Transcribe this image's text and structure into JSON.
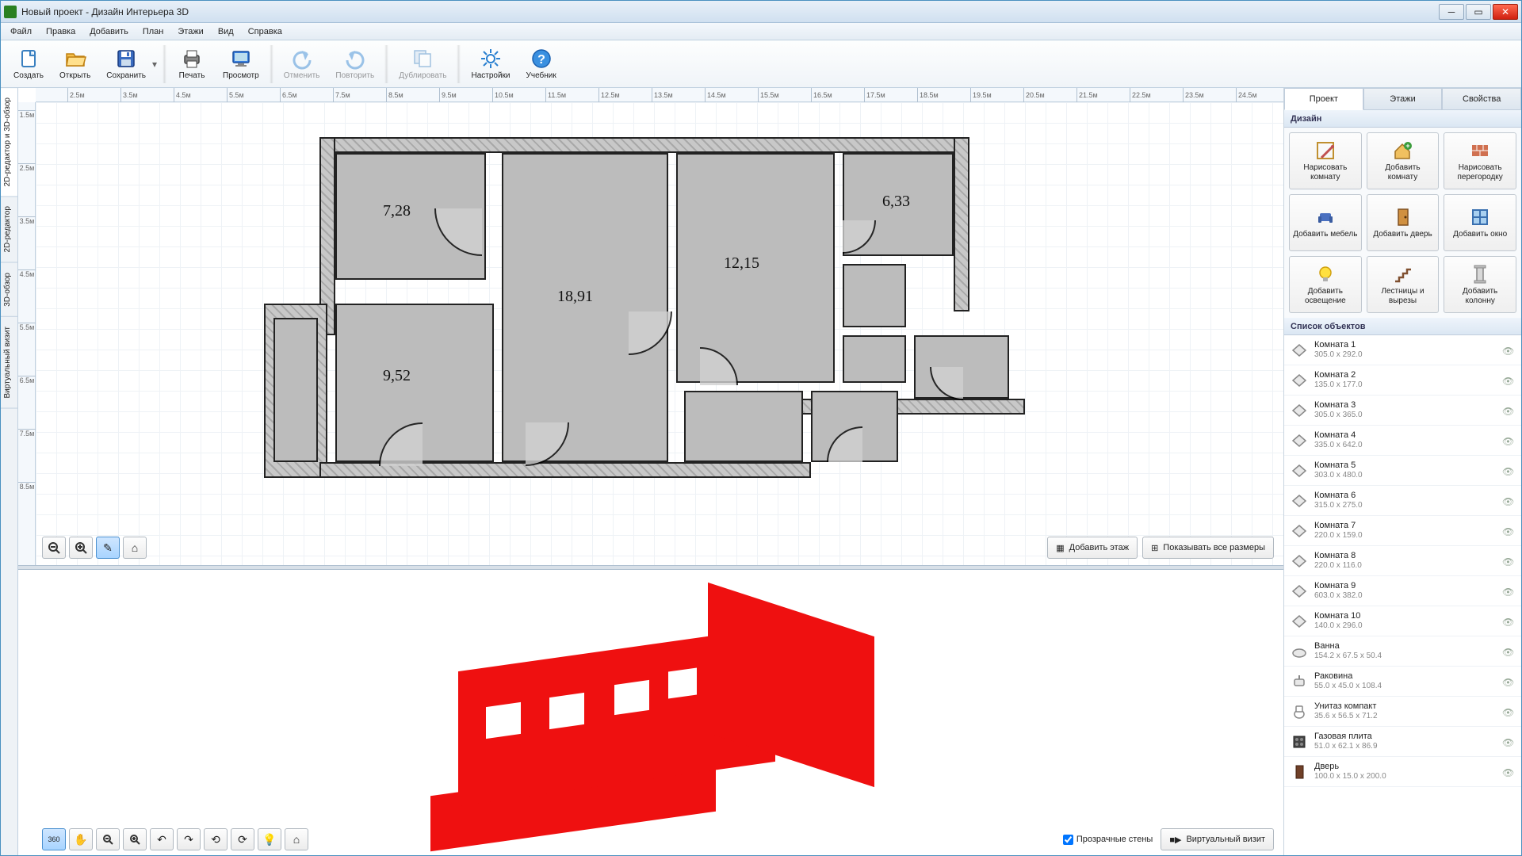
{
  "window_title": "Новый проект - Дизайн Интерьера 3D",
  "menu": [
    "Файл",
    "Правка",
    "Добавить",
    "План",
    "Этажи",
    "Вид",
    "Справка"
  ],
  "toolbar": [
    {
      "id": "new",
      "label": "Создать",
      "disabled": false
    },
    {
      "id": "open",
      "label": "Открыть",
      "disabled": false
    },
    {
      "id": "save",
      "label": "Сохранить",
      "disabled": false,
      "hasDropdown": true
    },
    {
      "sep": true
    },
    {
      "id": "print",
      "label": "Печать",
      "disabled": false
    },
    {
      "id": "preview",
      "label": "Просмотр",
      "disabled": false
    },
    {
      "sep": true
    },
    {
      "id": "undo",
      "label": "Отменить",
      "disabled": true
    },
    {
      "id": "redo",
      "label": "Повторить",
      "disabled": true
    },
    {
      "sep": true
    },
    {
      "id": "duplicate",
      "label": "Дублировать",
      "disabled": true
    },
    {
      "sep": true
    },
    {
      "id": "settings",
      "label": "Настройки",
      "disabled": false
    },
    {
      "id": "tutorial",
      "label": "Учебник",
      "disabled": false
    }
  ],
  "left_tabs": [
    "2D-редактор и 3D-обзор",
    "2D-редактор",
    "3D-обзор",
    "Виртуальный визит"
  ],
  "ruler_h": [
    "2.5м",
    "3.5м",
    "4.5м",
    "5.5м",
    "6.5м",
    "7.5м",
    "8.5м",
    "9.5м",
    "10.5м",
    "11.5м",
    "12.5м",
    "13.5м",
    "14.5м",
    "15.5м",
    "16.5м",
    "17.5м",
    "18.5м",
    "19.5м",
    "20.5м",
    "21.5м",
    "22.5м",
    "23.5м",
    "24.5м"
  ],
  "ruler_v": [
    "1.5м",
    "2.5м",
    "3.5м",
    "4.5м",
    "5.5м",
    "6.5м",
    "7.5м",
    "8.5м"
  ],
  "room_labels": {
    "r1": "7,28",
    "r2": "18,91",
    "r3": "12,15",
    "r4": "6,33",
    "r5": "9,52"
  },
  "canvas_buttons": {
    "add_floor": "Добавить этаж",
    "show_dims": "Показывать все размеры"
  },
  "canvas3d_footer": {
    "transparent_walls": "Прозрачные стены",
    "virtual_visit": "Виртуальный визит"
  },
  "right_tabs": [
    "Проект",
    "Этажи",
    "Свойства"
  ],
  "design_header": "Дизайн",
  "design_tools": [
    {
      "id": "draw-room",
      "label": "Нарисовать\nкомнату"
    },
    {
      "id": "add-room",
      "label": "Добавить\nкомнату"
    },
    {
      "id": "draw-wall",
      "label": "Нарисовать\nперегородку"
    },
    {
      "id": "add-furniture",
      "label": "Добавить\nмебель"
    },
    {
      "id": "add-door",
      "label": "Добавить\nдверь"
    },
    {
      "id": "add-window",
      "label": "Добавить\nокно"
    },
    {
      "id": "add-light",
      "label": "Добавить\nосвещение"
    },
    {
      "id": "stairs",
      "label": "Лестницы и\nвырезы"
    },
    {
      "id": "add-column",
      "label": "Добавить\nколонну"
    }
  ],
  "objects_header": "Список объектов",
  "objects": [
    {
      "name": "Комната 1",
      "dims": "305.0 x 292.0",
      "kind": "room"
    },
    {
      "name": "Комната 2",
      "dims": "135.0 x 177.0",
      "kind": "room"
    },
    {
      "name": "Комната 3",
      "dims": "305.0 x 365.0",
      "kind": "room"
    },
    {
      "name": "Комната 4",
      "dims": "335.0 x 642.0",
      "kind": "room"
    },
    {
      "name": "Комната 5",
      "dims": "303.0 x 480.0",
      "kind": "room"
    },
    {
      "name": "Комната 6",
      "dims": "315.0 x 275.0",
      "kind": "room"
    },
    {
      "name": "Комната 7",
      "dims": "220.0 x 159.0",
      "kind": "room"
    },
    {
      "name": "Комната 8",
      "dims": "220.0 x 116.0",
      "kind": "room"
    },
    {
      "name": "Комната 9",
      "dims": "603.0 x 382.0",
      "kind": "room"
    },
    {
      "name": "Комната 10",
      "dims": "140.0 x 296.0",
      "kind": "room"
    },
    {
      "name": "Ванна",
      "dims": "154.2 x 67.5 x 50.4",
      "kind": "bath"
    },
    {
      "name": "Раковина",
      "dims": "55.0 x 45.0 x 108.4",
      "kind": "sink"
    },
    {
      "name": "Унитаз компакт",
      "dims": "35.6 x 56.5 x 71.2",
      "kind": "toilet"
    },
    {
      "name": "Газовая плита",
      "dims": "51.0 x 62.1 x 86.9",
      "kind": "stove"
    },
    {
      "name": "Дверь",
      "dims": "100.0 x 15.0 x 200.0",
      "kind": "door"
    }
  ]
}
